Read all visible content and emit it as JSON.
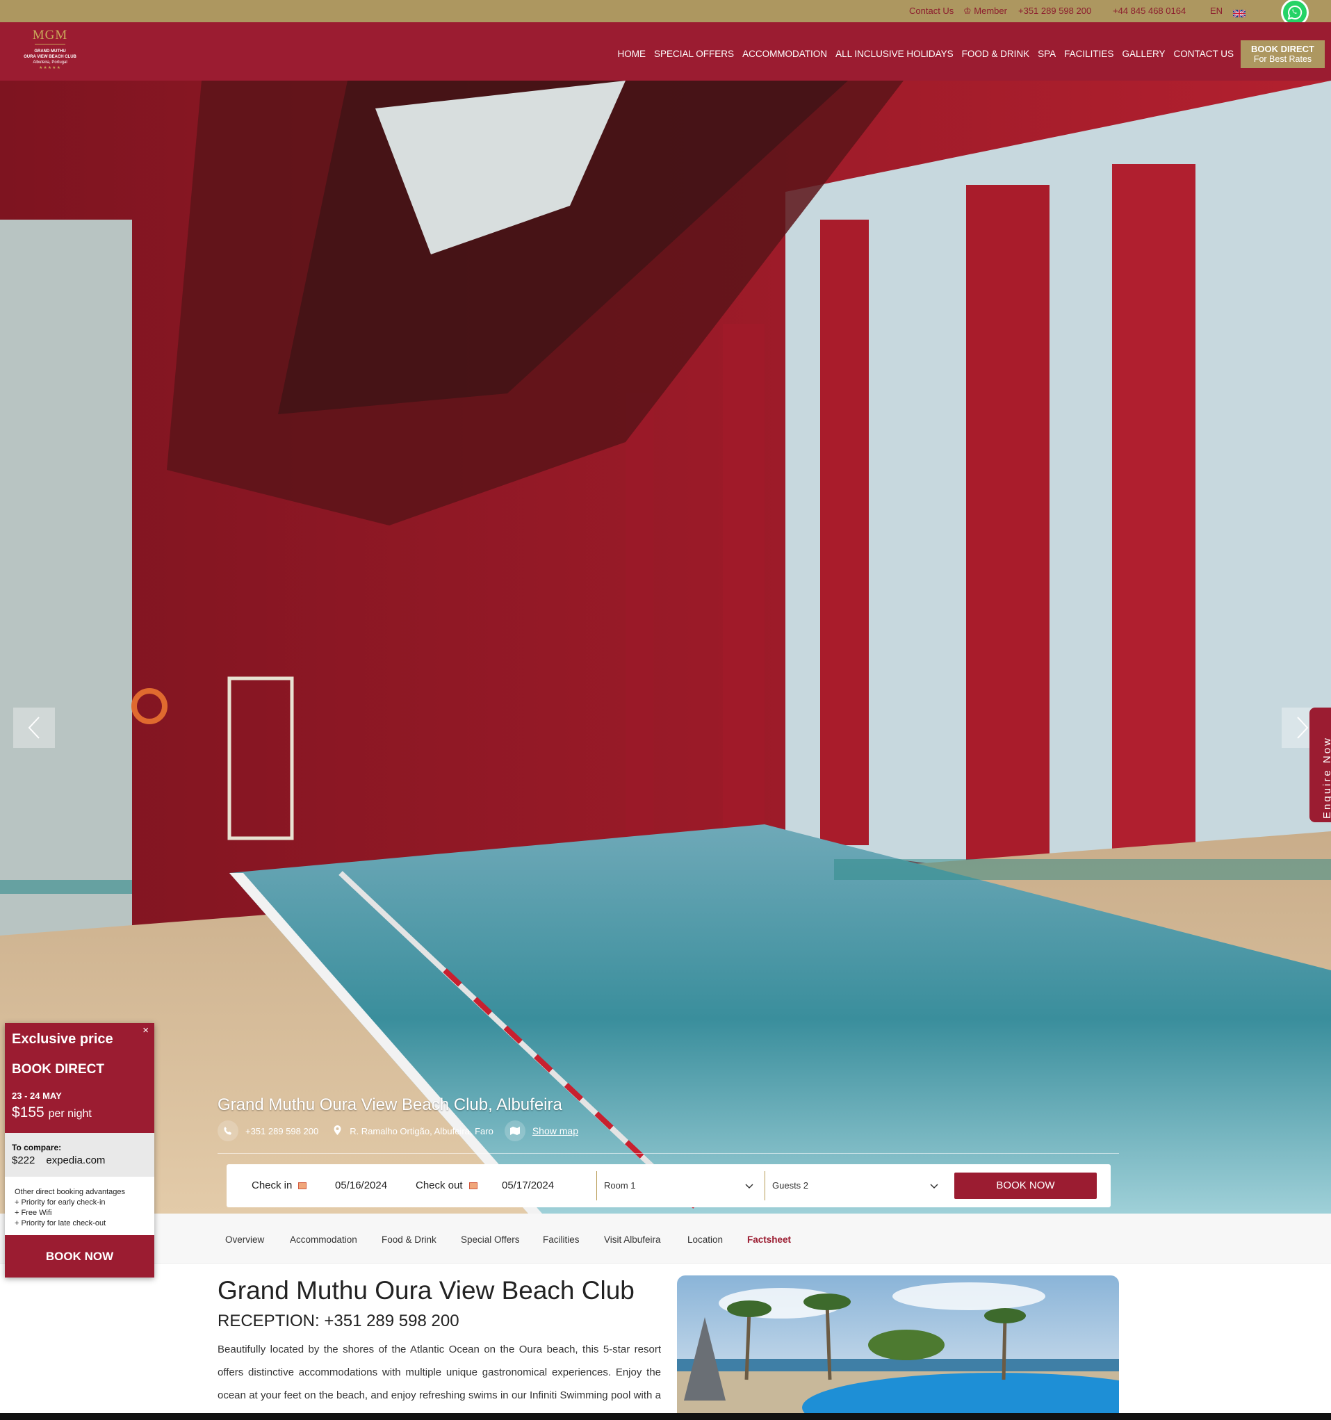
{
  "topbar": {
    "contact": "Contact Us",
    "member": "Member",
    "phone1": "+351 289 598 200",
    "phone2": "+44 845 468 0164",
    "lang": "EN"
  },
  "logo": {
    "brand": "MGM",
    "line1": "GRAND MUTHU",
    "line2": "OURA VIEW BEACH CLUB",
    "line3": "Albufeira, Portugal"
  },
  "nav": [
    "HOME",
    "SPECIAL OFFERS",
    "ACCOMMODATION",
    "ALL INCLUSIVE HOLIDAYS",
    "FOOD & DRINK",
    "SPA",
    "FACILITIES",
    "GALLERY",
    "CONTACT US"
  ],
  "book_direct": {
    "title": "BOOK DIRECT",
    "subtitle": "For Best Rates"
  },
  "enquire": "Enquire Now",
  "hero": {
    "title": "Grand Muthu Oura View Beach Club, Albufeira",
    "phone": "+351 289 598 200",
    "address": "R. Ramalho Ortigão, Albufeira, Faro",
    "map_link": "Show map"
  },
  "booking": {
    "checkin_label": "Check in",
    "checkin_value": "05/16/2024",
    "checkout_label": "Check out",
    "checkout_value": "05/17/2024",
    "room": "Room 1",
    "guests": "Guests 2",
    "button": "BOOK NOW"
  },
  "subnav": [
    {
      "label": "Overview",
      "active": false
    },
    {
      "label": "Accommodation",
      "active": false
    },
    {
      "label": "Food & Drink",
      "active": false
    },
    {
      "label": "Special Offers",
      "active": false
    },
    {
      "label": "Facilities",
      "active": false
    },
    {
      "label": "Visit Albufeira",
      "active": false
    },
    {
      "label": "Location",
      "active": false
    },
    {
      "label": "Factsheet",
      "active": true
    }
  ],
  "main": {
    "title": "Grand Muthu Oura View Beach Club",
    "reception": "RECEPTION: +351 289 598 200",
    "description": "Beautifully located by the shores of the Atlantic Ocean on the Oura beach, this 5-star resort offers distinctive accommodations with multiple unique gastronomical experiences. Enjoy the ocean at your feet on the beach, and enjoy refreshing swims in our Infiniti Swimming pool with a water slide and diving areas. We also offer a separate pool for children"
  },
  "popup": {
    "close": "×",
    "heading": "Exclusive price",
    "subheading": "BOOK DIRECT",
    "dates": "23 - 24 MAY",
    "price": "$155",
    "per_night": "per night",
    "compare_label": "To compare:",
    "compare_price": "$222",
    "compare_site": "expedia.com",
    "adv_title": "Other direct booking advantages",
    "adv_items": [
      "+ Priority for early check-in",
      "+ Free Wifi",
      "+ Priority for late check-out"
    ],
    "button": "BOOK NOW"
  },
  "colors": {
    "brand": "#9b1c31",
    "gold": "#ad9760"
  }
}
